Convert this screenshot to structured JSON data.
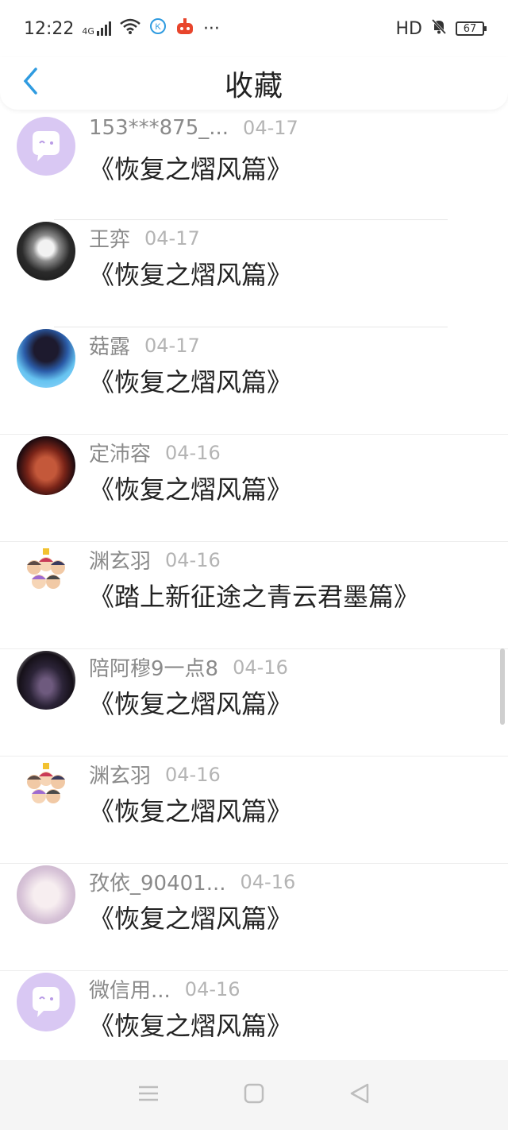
{
  "status": {
    "time": "12:22",
    "network": "4G",
    "hd": "HD",
    "battery": "67",
    "more": "···"
  },
  "header": {
    "title": "收藏"
  },
  "items": [
    {
      "user": "153***875_...",
      "date": "04-17",
      "title": "《恢复之熠风篇》",
      "avatar": "default-avatar"
    },
    {
      "user": "王弈",
      "date": "04-17",
      "title": "《恢复之熠风篇》",
      "avatar": "anime-girl-avatar"
    },
    {
      "user": "菇露",
      "date": "04-17",
      "title": "《恢复之熠风篇》",
      "avatar": "anime-boy-avatar"
    },
    {
      "user": "定沛容",
      "date": "04-16",
      "title": "《恢复之熠风篇》",
      "avatar": "tattoo-back-avatar"
    },
    {
      "user": "渊玄羽",
      "date": "04-16",
      "title": "《踏上新征途之青云君墨篇》",
      "avatar": "group-cartoon-avatar"
    },
    {
      "user": "陪阿穆9一点8",
      "date": "04-16",
      "title": "《恢复之熠风篇》",
      "avatar": "dark-scene-avatar"
    },
    {
      "user": "渊玄羽",
      "date": "04-16",
      "title": "《恢复之熠风篇》",
      "avatar": "group-cartoon-avatar"
    },
    {
      "user": "孜依_90401...",
      "date": "04-16",
      "title": "《恢复之熠风篇》",
      "avatar": "sketch-girl-avatar"
    },
    {
      "user": "微信用...",
      "date": "04-16",
      "title": "《恢复之熠风篇》",
      "avatar": "default-avatar"
    }
  ],
  "colors": {
    "accent": "#2f9be0",
    "default_avatar": "#d9c8f3"
  }
}
